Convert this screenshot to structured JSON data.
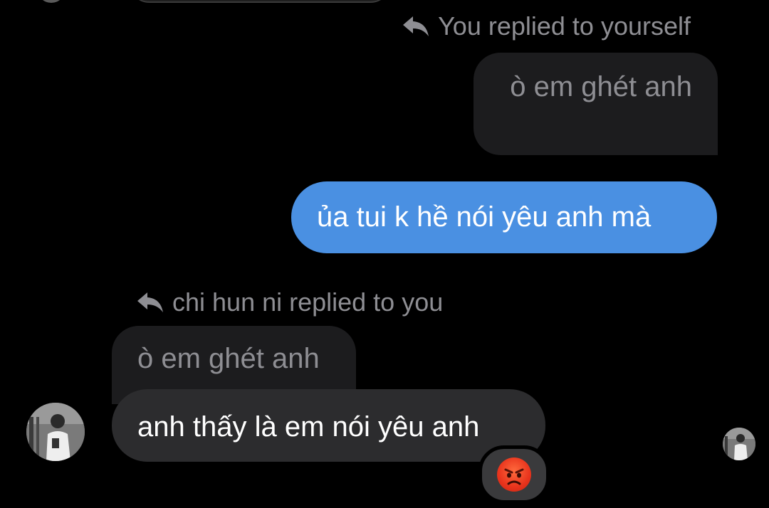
{
  "conversation": {
    "reply_context_1": "You replied to yourself",
    "quoted_message_1": "ò em ghét anh",
    "sent_message": "ủa tui k hề nói yêu anh mà",
    "reply_context_2": "chi hun ni replied to you",
    "quoted_message_2": "ò em ghét anh",
    "received_message": "anh thấy là em nói yêu anh",
    "reaction": "😡"
  },
  "colors": {
    "background": "#000000",
    "sent_bubble": "#4a90e2",
    "received_bubble": "#2c2c2e",
    "quoted_bubble": "#1c1c1e",
    "muted_text": "#8e8e93"
  },
  "icons": {
    "reply": "reply-arrow-icon",
    "reaction": "angry-face-emoji"
  }
}
